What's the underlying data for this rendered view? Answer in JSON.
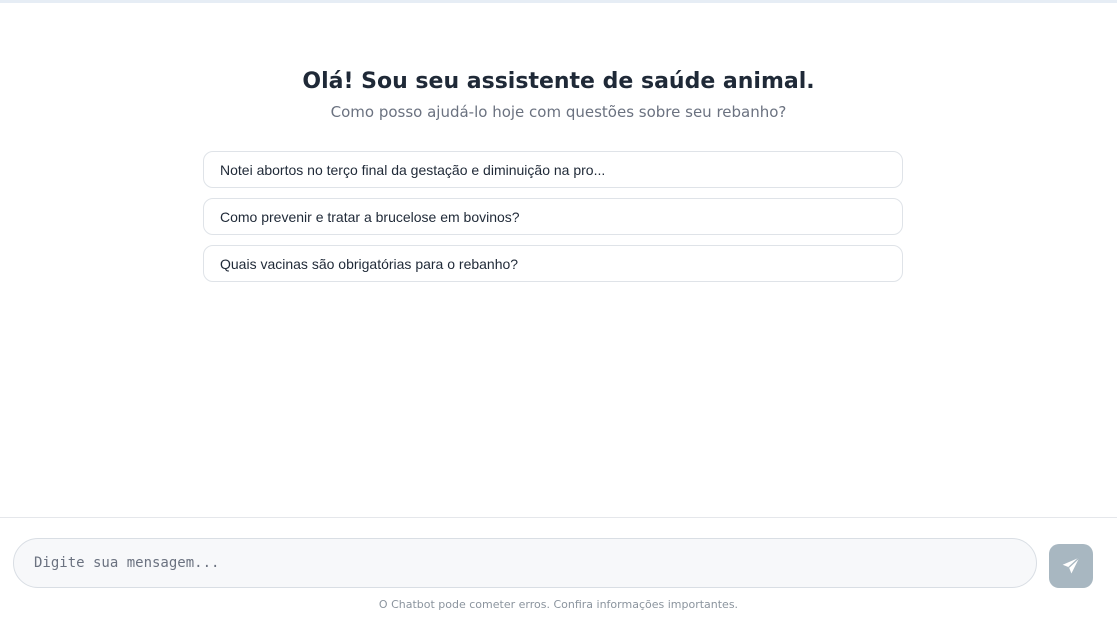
{
  "welcome": {
    "title": "Olá! Sou seu assistente de saúde animal.",
    "subtitle": "Como posso ajudá-lo hoje com questões sobre seu rebanho?"
  },
  "suggestions": [
    {
      "label": "Notei abortos no terço final da gestação e diminuição na pro..."
    },
    {
      "label": "Como prevenir e tratar a brucelose em bovinos?"
    },
    {
      "label": "Quais vacinas são obrigatórias para o rebanho?"
    }
  ],
  "composer": {
    "placeholder": "Digite sua mensagem...",
    "value": "",
    "send_icon": "paper-plane-icon",
    "send_button_color": "#a8b7c1"
  },
  "footer": {
    "disclaimer": "O Chatbot pode cometer erros. Confira informações importantes."
  },
  "colors": {
    "title": "#1f2937",
    "subtitle": "#6b7280",
    "border": "#dfe3e8"
  }
}
